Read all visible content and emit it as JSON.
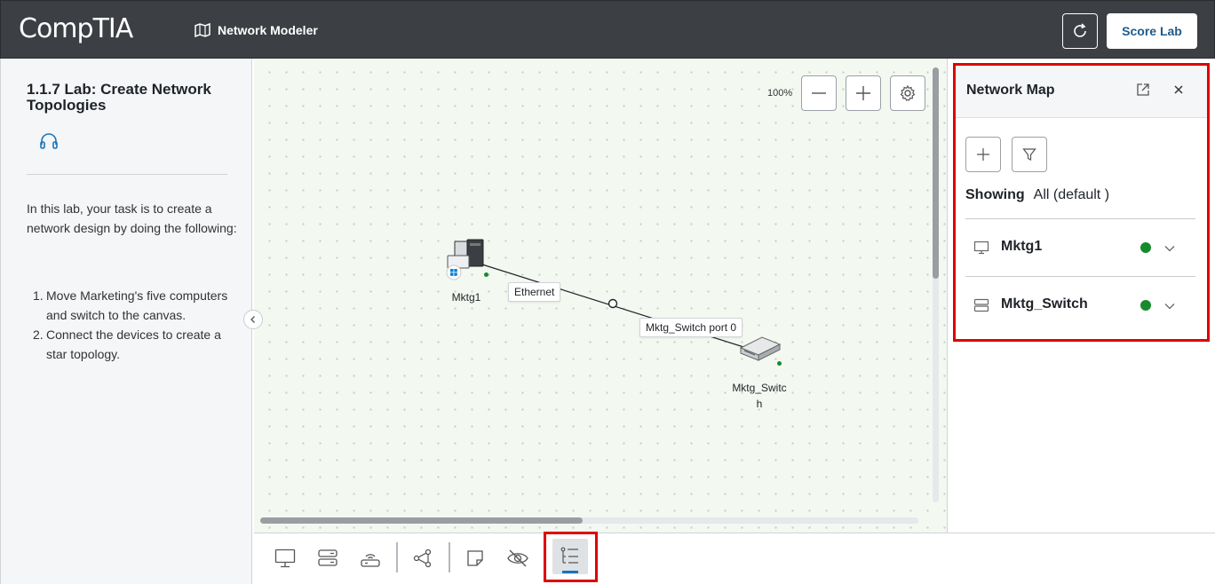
{
  "header": {
    "logo": "CompTIA",
    "app_title": "Network Modeler",
    "score_button": "Score Lab"
  },
  "instructions": {
    "title": "1.1.7 Lab: Create Network Topologies",
    "intro": "In this lab, your task is to create a network design by doing the following:",
    "tasks": [
      {
        "num": "1.",
        "text": "Move Marketing's five computers and switch to the canvas."
      },
      {
        "num": "2.",
        "text": "Connect the devices to create a star topology."
      }
    ]
  },
  "canvas": {
    "zoom": "100%",
    "devices": [
      {
        "name": "Mktg1",
        "type": "computer-icon"
      },
      {
        "name": "Mktg_Switch",
        "type": "switch-icon"
      }
    ],
    "links": [
      {
        "label_a": "Ethernet",
        "label_b": "Mktg_Switch port 0"
      }
    ]
  },
  "network_map": {
    "title": "Network Map",
    "showing_label": "Showing",
    "showing_value": "All (default )",
    "rows": [
      {
        "name": "Mktg1",
        "icon": "monitor-icon",
        "status_color": "#178a2c"
      },
      {
        "name": "Mktg_Switch",
        "icon": "server-icon",
        "status_color": "#178a2c"
      }
    ]
  },
  "colors": {
    "header_bg": "#3c3f43",
    "accent": "#1e5a8a",
    "highlight": "#e00000",
    "status_ok": "#178a2c"
  }
}
